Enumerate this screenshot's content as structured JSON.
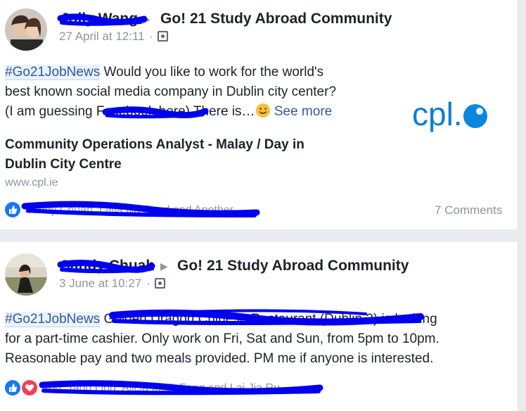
{
  "posts": [
    {
      "author": "Jolly Wang",
      "group": "Go! 21 Study Abroad Community",
      "time": "27 April at 12:11",
      "hashtag": "#Go21JobNews",
      "text_line1": " Would you like to work for the world's",
      "text_line2": "best known social media company in Dublin city center?",
      "text_line3_a": "(I am guessing ",
      "text_line3_redacted": "Facebook here",
      "text_line3_b": ") There is…",
      "see_more": "See more",
      "link_title_line1": "Community Operations Analyst - Malay / Day in",
      "link_title_line2": "Dublin City Centre",
      "link_domain": "www.cpl.ie",
      "logo_text": "cpl.",
      "reactions": "Sandy Chuah, Laila Ilia Rusd and Another",
      "comments": "7 Comments"
    },
    {
      "author": "Sandy Chuah",
      "group": "Go! 21 Study Abroad Community",
      "time": "3 June at 10:27",
      "hashtag": "#Go21JobNews",
      "text_line1_redacted": " Golden Dragon Chinese Restaurant (Dublin 2)",
      "text_line1_b": " is looking",
      "text_line2": "for a part-time cashier. Only work on Fri, Sat and Sun, from 5pm to 10pm.",
      "text_line3": "Reasonable pay and two meals provided. PM me if anyone is interested.",
      "reactions": "You, Tang Ling, Alicia Imek Fong and Lai Jia Ru"
    }
  ],
  "colors": {
    "link": "#365899",
    "like": "#1877f2",
    "love": "#f33e58",
    "redaction": "#0000ee",
    "cpl": "#0a7ed6"
  }
}
